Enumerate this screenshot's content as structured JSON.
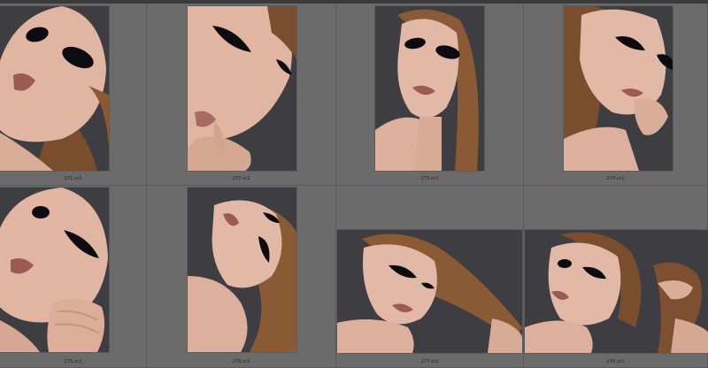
{
  "thumbnails": [
    {
      "filename": "271.cr2",
      "subject": "model portrait, dark eye makeup, head tilted"
    },
    {
      "filename": "272.cr2",
      "subject": "close-up face, hand at lips"
    },
    {
      "filename": "273.cr2",
      "subject": "model portrait, bare shoulder"
    },
    {
      "filename": "274.cr2",
      "subject": "model portrait, hand at cheek"
    },
    {
      "filename": "275.cr2",
      "subject": "model portrait, hand at chin"
    },
    {
      "filename": "276.cr2",
      "subject": "model portrait, head tilted back"
    },
    {
      "filename": "277.cr2",
      "subject": "model holding hair, landscape"
    },
    {
      "filename": "278.cr2",
      "subject": "model holding hair up, landscape"
    }
  ],
  "colors": {
    "background": "#6a6a6a",
    "studio_backdrop": "#3e3d42",
    "skin": "#e2b9a6",
    "hair": "#8a5a34",
    "makeup": "#0c0c10"
  }
}
